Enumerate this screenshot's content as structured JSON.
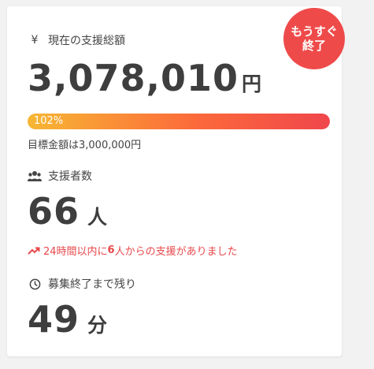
{
  "badge": {
    "line1": "もうすぐ",
    "line2": "終了"
  },
  "funding": {
    "label": "現在の支援総額",
    "icon": "yen-icon",
    "amount": "3,078,010",
    "unit": "円",
    "progress_label": "102%",
    "progress_fraction": 1.0,
    "goal_text": "目標金額は3,000,000円"
  },
  "supporters": {
    "label": "支援者数",
    "icon": "people-icon",
    "count": "66",
    "unit": "人",
    "recent_prefix": "24時間以内に",
    "recent_count": "6",
    "recent_suffix": "人からの支援がありました"
  },
  "time_left": {
    "label": "募集終了まで残り",
    "icon": "clock-icon",
    "value": "49",
    "unit": "分"
  },
  "colors": {
    "accent": "#ef4a4a",
    "text": "#3e3e3e",
    "gradient_start": "#f7b733",
    "gradient_end": "#f0464c"
  }
}
